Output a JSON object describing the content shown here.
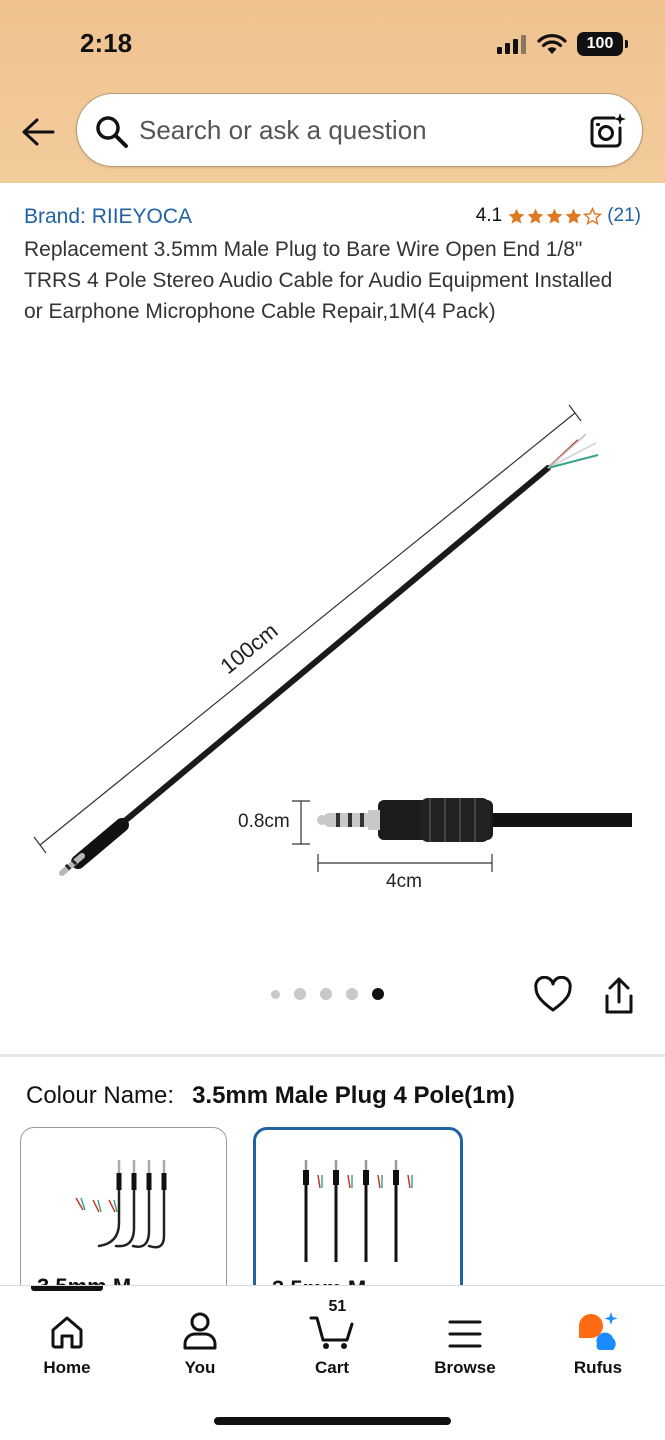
{
  "status_bar": {
    "time": "2:18",
    "battery": "100"
  },
  "search": {
    "placeholder": "Search or ask a question"
  },
  "product": {
    "brand": "Brand: RIIEYOCA",
    "rating": "4.1",
    "rating_stars": 4.1,
    "review_count": "(21)",
    "title": "Replacement 3.5mm Male Plug to Bare Wire Open End 1/8\" TRRS 4 Pole Stereo Audio Cable for Audio Equipment Installed or Earphone Microphone Cable Repair,1M(4 Pack)"
  },
  "image": {
    "length_label": "100cm",
    "diameter_label": "0.8cm",
    "plug_length_label": "4cm",
    "total_images": 5,
    "active_index": 4
  },
  "colour": {
    "label": "Colour Name:",
    "value": "3.5mm Male Plug 4 Pole(1m)",
    "options": [
      {
        "label": "3.5mm M"
      },
      {
        "label": "3.5mm M"
      }
    ]
  },
  "nav": {
    "items": [
      {
        "label": "Home"
      },
      {
        "label": "You"
      },
      {
        "label": "Cart"
      },
      {
        "label": "Browse"
      },
      {
        "label": "Rufus"
      }
    ],
    "cart_count": "51"
  },
  "colors": {
    "accent": "#2162a1",
    "header": "#efc28f",
    "star": "#de7921",
    "rufus_orange": "#ff6a13",
    "rufus_blue": "#1a8cff"
  }
}
